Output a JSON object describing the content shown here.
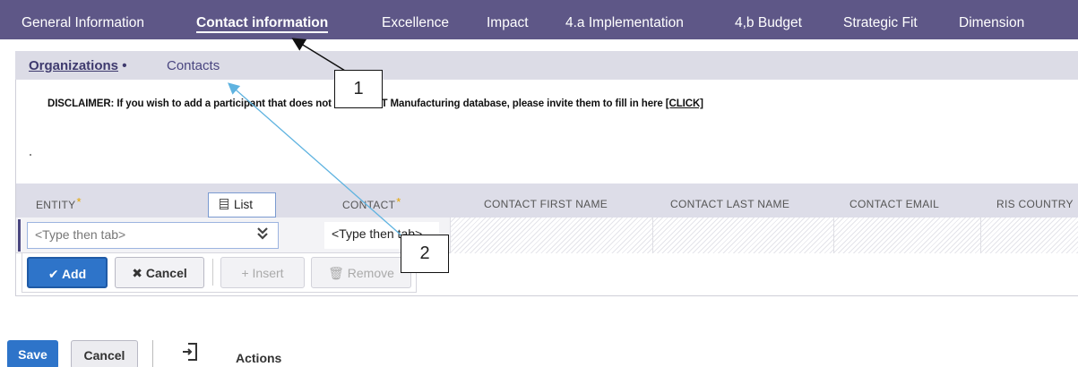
{
  "top_tabs": [
    {
      "label": "General Information",
      "active": false
    },
    {
      "label": "Contact information",
      "active": true
    },
    {
      "label": "Excellence",
      "active": false
    },
    {
      "label": "Impact",
      "active": false
    },
    {
      "label": "4.a Implementation",
      "active": false
    },
    {
      "label": "4,b Budget",
      "active": false
    },
    {
      "label": "Strategic Fit",
      "active": false
    },
    {
      "label": "Dimension",
      "active": false
    }
  ],
  "sub_tabs": [
    {
      "label": "Organizations",
      "suffix": "•",
      "active": true
    },
    {
      "label": "Contacts",
      "active": false
    }
  ],
  "disclaimer": {
    "text": "DISCLAIMER: If you wish to add a participant that does not exist in EIT Manufacturing database, please invite them to fill in here ",
    "link": "[CLICK]"
  },
  "table": {
    "columns": [
      {
        "label": "ENTITY",
        "required": true
      },
      {
        "label": "CONTACT",
        "required": true
      },
      {
        "label": "CONTACT FIRST NAME",
        "required": false
      },
      {
        "label": "CONTACT LAST NAME",
        "required": false
      },
      {
        "label": "CONTACT EMAIL",
        "required": false
      },
      {
        "label": "RIS COUNTRY",
        "required": false
      }
    ],
    "required_marker": "*",
    "entity_placeholder": "<Type then tab>",
    "contact_placeholder": "<Type then tab>",
    "list_popup_label": "List"
  },
  "row_buttons": {
    "add": "Add",
    "cancel": "Cancel",
    "insert": "Insert",
    "remove": "Remove"
  },
  "callouts": [
    "1",
    "2"
  ],
  "footer": {
    "save": "Save",
    "cancel": "Cancel",
    "actions": "Actions"
  },
  "colors": {
    "nav_bg": "#5e5787",
    "subnav_bg": "#dcdce6",
    "primary_button": "#2e74c9",
    "required_star": "#e5a400",
    "callout_arrow_1": "#111111",
    "callout_arrow_2": "#5fb3e0"
  },
  "icons": {
    "add": "check-icon",
    "cancel": "x-icon",
    "insert": "plus-icon",
    "remove": "trash-icon",
    "entity_dropdown": "double-chevron-down-icon",
    "list": "list-icon",
    "actions": "page-arrow-icon"
  }
}
